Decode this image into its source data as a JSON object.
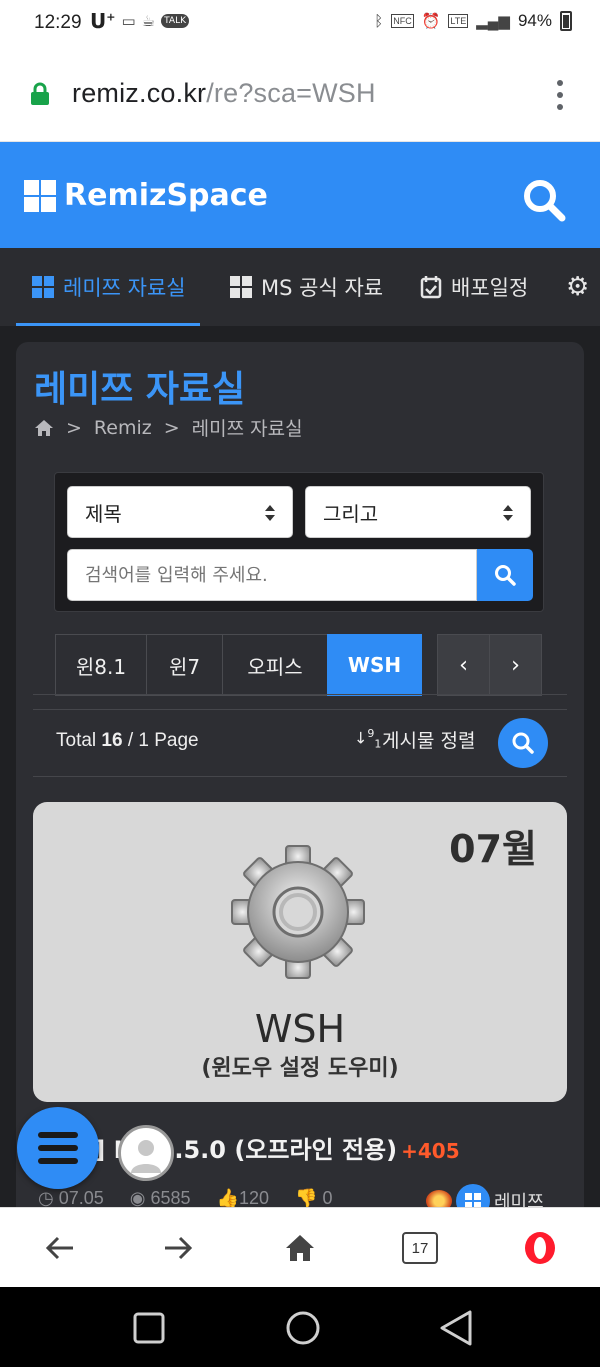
{
  "status_bar": {
    "time": "12:29",
    "battery": "94%",
    "left_icons": [
      "carrier-icon",
      "message-icon",
      "coffee-icon",
      "talk-icon"
    ],
    "right_icons": [
      "bluetooth-icon",
      "nfc-icon",
      "alarm-icon",
      "lte-icon",
      "signal-icon",
      "battery-icon"
    ]
  },
  "browser": {
    "url_host": "remiz.co.kr",
    "url_path": "/re?sca=WSH",
    "tab_count": "17"
  },
  "header": {
    "brand": "RemizSpace"
  },
  "nav": {
    "tabs": [
      {
        "label": "레미쯔 자료실",
        "active": true
      },
      {
        "label": "MS 공식 자료",
        "active": false
      },
      {
        "label": "배포일정",
        "active": false
      }
    ]
  },
  "page": {
    "title": "레미쯔 자료실",
    "breadcrumb": [
      "Remiz",
      "레미쯔 자료실"
    ],
    "separator": ">"
  },
  "search": {
    "field_select": "제목",
    "operator_select": "그리고",
    "placeholder": "검색어를 입력해 주세요."
  },
  "categories": [
    {
      "label": "윈8.1",
      "active": false
    },
    {
      "label": "윈7",
      "active": false
    },
    {
      "label": "오피스",
      "active": false
    },
    {
      "label": "WSH",
      "active": true
    }
  ],
  "pager": {
    "prev": "‹",
    "next": "›"
  },
  "listing": {
    "total_label": "Total",
    "total": "16",
    "pages": "/ 1 Page",
    "sort_label": "게시물 정렬"
  },
  "post": {
    "thumb_month": "07월",
    "thumb_title": "WSH",
    "thumb_subtitle": "(윈도우 설정 도우미)",
    "title_visible": "l] ",
    "title_rest": "H v2.5.0 (오프라인 전용)",
    "comment_count": "+405",
    "date": "07.05",
    "views": "6585",
    "likes": "120",
    "dislikes": "0",
    "author": "레미쯔"
  },
  "colors": {
    "brand": "#2f8cf5",
    "dark_bg": "#1f2023",
    "panel": "#2d2e33",
    "accent_orange": "#ff5a2b"
  }
}
